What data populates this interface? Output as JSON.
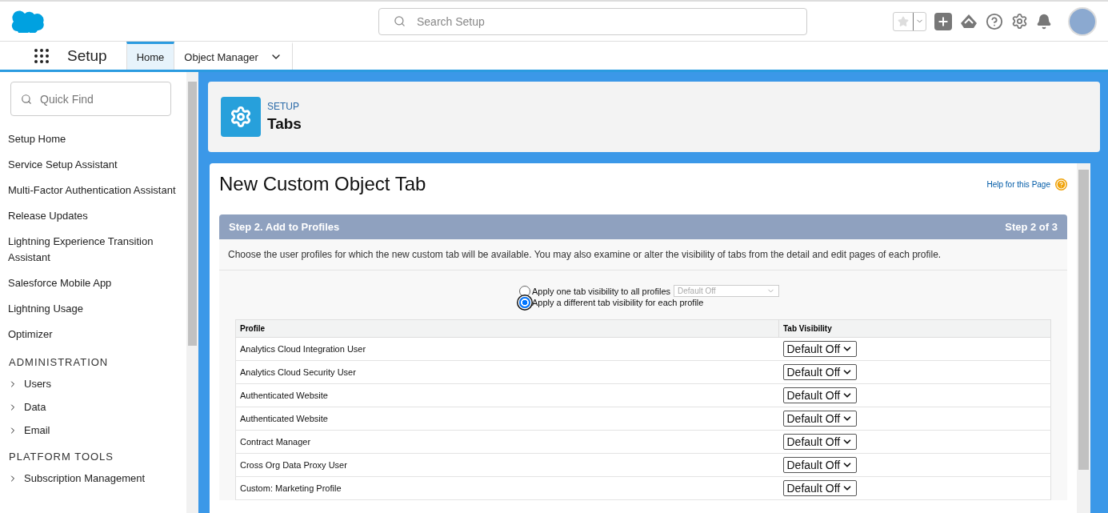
{
  "header": {
    "search": {
      "placeholder": "Search Setup"
    }
  },
  "nav": {
    "app_name": "Setup",
    "tabs": [
      {
        "label": "Home",
        "selected": true,
        "menu": false
      },
      {
        "label": "Object Manager",
        "selected": false,
        "menu": true
      }
    ]
  },
  "sidebar": {
    "quick_find": {
      "placeholder": "Quick Find"
    },
    "items": [
      {
        "kind": "link",
        "label": "Setup Home"
      },
      {
        "kind": "link",
        "label": "Service Setup Assistant"
      },
      {
        "kind": "link",
        "label": "Multi-Factor Authentication Assistant"
      },
      {
        "kind": "link",
        "label": "Release Updates"
      },
      {
        "kind": "link",
        "label": "Lightning Experience Transition Assistant"
      },
      {
        "kind": "link",
        "label": "Salesforce Mobile App"
      },
      {
        "kind": "link",
        "label": "Lightning Usage"
      },
      {
        "kind": "link",
        "label": "Optimizer"
      },
      {
        "kind": "section",
        "label": "ADMINISTRATION"
      },
      {
        "kind": "group",
        "label": "Users",
        "expanded": false
      },
      {
        "kind": "group",
        "label": "Data",
        "expanded": false
      },
      {
        "kind": "group",
        "label": "Email",
        "expanded": false
      },
      {
        "kind": "section",
        "label": "PLATFORM TOOLS"
      },
      {
        "kind": "group",
        "label": "Subscription Management",
        "expanded": false
      }
    ]
  },
  "page_header": {
    "eyebrow": "SETUP",
    "title": "Tabs"
  },
  "content": {
    "title": "New Custom Object Tab",
    "help_link": "Help for this Page",
    "step": {
      "title": "Step 2. Add to Profiles",
      "counter": "Step 2 of 3"
    },
    "description": "Choose the user profiles for which the new custom tab will be available. You may also examine or alter the visibility of tabs from the detail and edit pages of each profile.",
    "options": [
      {
        "label": "Apply one tab visibility to all profiles",
        "selected": false,
        "select": {
          "value": "Default Off",
          "disabled": true
        }
      },
      {
        "label": "Apply a different tab visibility for each profile",
        "selected": true
      }
    ],
    "table": {
      "columns": [
        "Profile",
        "Tab Visibility"
      ],
      "rows": [
        {
          "profile": "Analytics Cloud Integration User",
          "visibility": "Default Off"
        },
        {
          "profile": "Analytics Cloud Security User",
          "visibility": "Default Off"
        },
        {
          "profile": "Authenticated Website",
          "visibility": "Default Off"
        },
        {
          "profile": "Authenticated Website",
          "visibility": "Default Off"
        },
        {
          "profile": "Contract Manager",
          "visibility": "Default Off"
        },
        {
          "profile": "Cross Org Data Proxy User",
          "visibility": "Default Off"
        },
        {
          "profile": "Custom: Marketing Profile",
          "visibility": "Default Off"
        }
      ]
    }
  }
}
